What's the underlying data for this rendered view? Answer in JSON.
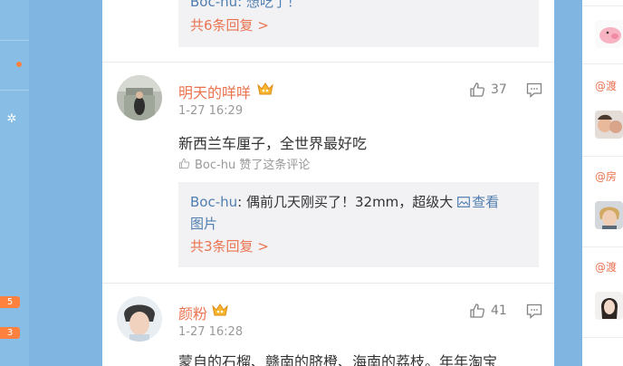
{
  "left_badges": [
    "5",
    "3"
  ],
  "top_reply": {
    "partial_text": "Boc-hu: 想吃了！",
    "more": "共6条回复 >"
  },
  "comments": [
    {
      "user": "明天的咩咩",
      "time": "1-27 16:29",
      "likes": "37",
      "text": "新西兰车厘子，全世界最好吃",
      "liked_by": "Boc-hu 赞了这条评论",
      "reply_user": "Boc-hu",
      "reply_text_1": ": 偶前几天刚买了！32mm，超级大 ",
      "reply_link": "查看",
      "reply_text_2": "图片",
      "reply_more": "共3条回复 >"
    },
    {
      "user": "颜粉",
      "time": "1-27 16:28",
      "likes": "41",
      "text": "蒙自的石榴、赣南的脐橙、海南的荔枝。年年淘宝"
    }
  ],
  "right_labels": [
    "@渡",
    "@房",
    "@渡"
  ],
  "colors": {
    "accent": "#eb7350",
    "link": "#507daf",
    "badge": "#ff8140"
  }
}
